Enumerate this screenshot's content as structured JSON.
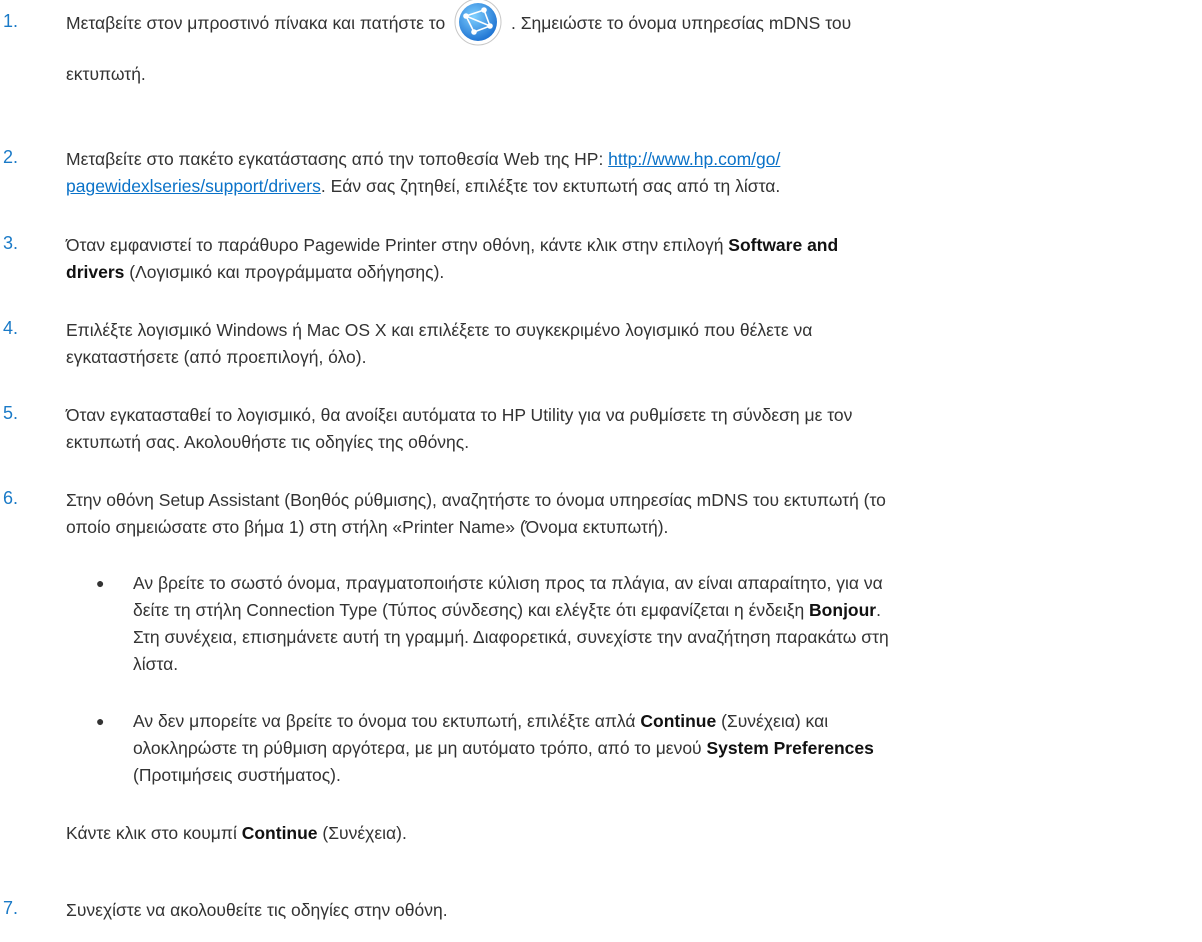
{
  "steps": [
    {
      "num": "1.",
      "text_before_icon": "Μεταβείτε στον μπροστινό πίνακα και πατήστε το",
      "icon": "network-globe-icon",
      "text_after_icon": ". Σημειώστε το όνομα υπηρεσίας mDNS του",
      "text_line2": "εκτυπωτή."
    },
    {
      "num": "2.",
      "text_before_link": "Μεταβείτε στο πακέτο εγκατάστασης από την τοποθεσία Web της HP: ",
      "link_part1": "http://www.hp.com/go/",
      "link_part2": "pagewidexlseries/support/drivers",
      "text_after_link": ". Εάν σας ζητηθεί, επιλέξτε τον εκτυπωτή σας από τη λίστα."
    },
    {
      "num": "3.",
      "line1_before_bold": "Όταν εμφανιστεί το παράθυρο Pagewide Printer στην οθόνη, κάντε κλικ στην επιλογή ",
      "bold1": "Software and",
      "bold2": "drivers",
      "line2_after_bold": " (Λογισμικό και προγράμματα οδήγησης)."
    },
    {
      "num": "4.",
      "line1": "Επιλέξτε λογισμικό Windows ή Mac OS X και επιλέξετε το συγκεκριμένο λογισμικό που θέλετε να",
      "line2": "εγκαταστήσετε (από προεπιλογή, όλο)."
    },
    {
      "num": "5.",
      "line1": "Όταν εγκατασταθεί το λογισμικό, θα ανοίξει αυτόματα το HP Utility για να ρυθμίσετε τη σύνδεση με τον",
      "line2": "εκτυπωτή σας. Ακολουθήστε τις οδηγίες της οθόνης."
    },
    {
      "num": "6.",
      "line1": "Στην οθόνη Setup Assistant (Βοηθός ρύθμισης), αναζητήστε το όνομα υπηρεσίας mDNS του εκτυπωτή (το",
      "line2": "οποίο σημειώσατε στο βήμα 1) στη στήλη «Printer Name» (Όνομα εκτυπωτή).",
      "bullets": [
        {
          "l1": "Αν βρείτε το σωστό όνομα, πραγματοποιήστε κύλιση προς τα πλάγια, αν είναι απαραίτητο, για να",
          "l2_before_bold": "δείτε τη στήλη Connection Type (Τύπος σύνδεσης) και ελέγξτε ότι εμφανίζεται η ένδειξη ",
          "l2_bold": "Bonjour",
          "l2_after_bold": ".",
          "l3": "Στη συνέχεια, επισημάνετε αυτή τη γραμμή. Διαφορετικά, συνεχίστε την αναζήτηση παρακάτω στη",
          "l4": "λίστα."
        },
        {
          "l1_before_bold": "Αν δεν μπορείτε να βρείτε το όνομα του εκτυπωτή, επιλέξτε απλά ",
          "l1_bold": "Continue",
          "l1_after_bold": " (Συνέχεια) και",
          "l2_before_bold": "ολοκληρώστε τη ρύθμιση αργότερα, με μη αυτόματο τρόπο, από το μενού ",
          "l2_bold": "System Preferences",
          "l3": "(Προτιμήσεις συστήματος)."
        }
      ],
      "after_before_bold": "Κάντε κλικ στο κουμπί ",
      "after_bold": "Continue",
      "after_after_bold": " (Συνέχεια)."
    },
    {
      "num": "7.",
      "line1": "Συνεχίστε να ακολουθείτε τις οδηγίες στην οθόνη."
    }
  ],
  "colors": {
    "number": "#1a7ac7",
    "link": "#0a72c8",
    "text": "#333333"
  }
}
